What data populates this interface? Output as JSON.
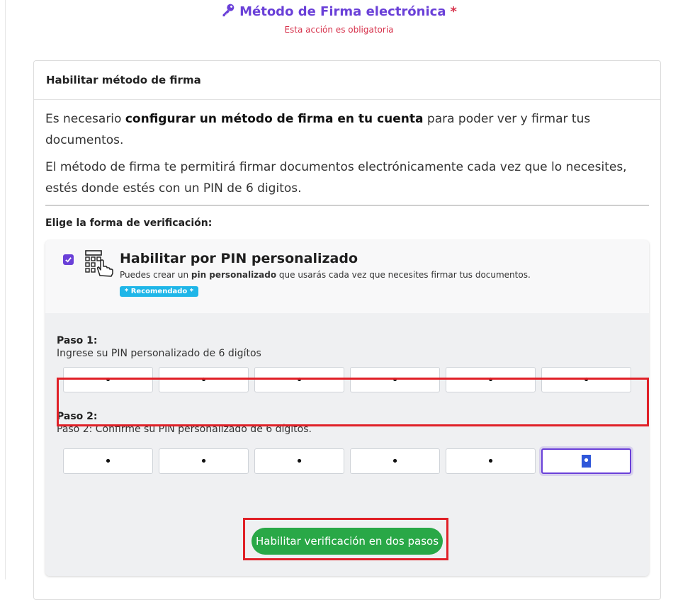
{
  "header": {
    "title": "Método de Firma electrónica",
    "required_mark": "*",
    "subtitle": "Esta acción es obligatoria"
  },
  "card": {
    "title": "Habilitar método de firma",
    "para1": {
      "prefix": "Es necesario ",
      "bold": "configurar un método de firma en tu cuenta",
      "suffix": " para poder ver y firmar tus documentos."
    },
    "para2": "El método de firma te permitirá firmar documentos electrónicamente cada vez que lo necesites, estés donde estés con un PIN de 6 digitos.",
    "choose_label": "Elige la forma de verificación:"
  },
  "option": {
    "checked": true,
    "title": "Habilitar por PIN personalizado",
    "desc_prefix": "Puedes crear un ",
    "desc_bold": "pin personalizado",
    "desc_suffix": " que usarás cada vez que necesites firmar tus documentos.",
    "badge": "* Recomendado *"
  },
  "step1": {
    "title": "Paso 1:",
    "desc": "Ingrese su PIN personalizado de 6 digítos",
    "pins": [
      "•",
      "•",
      "•",
      "•",
      "•",
      "•"
    ]
  },
  "step2": {
    "title": "Paso 2:",
    "desc": "Paso 2: Confirme su PIN personalizado de 6 dígitos.",
    "pins": [
      "•",
      "•",
      "•",
      "•",
      "•",
      "•"
    ]
  },
  "submit_label": "Habilitar verificación en dos pasos",
  "colors": {
    "accent": "#6a40d8",
    "required": "#d6304a",
    "button": "#29a847",
    "badge": "#1fb6e8",
    "highlight": "#e02027"
  }
}
